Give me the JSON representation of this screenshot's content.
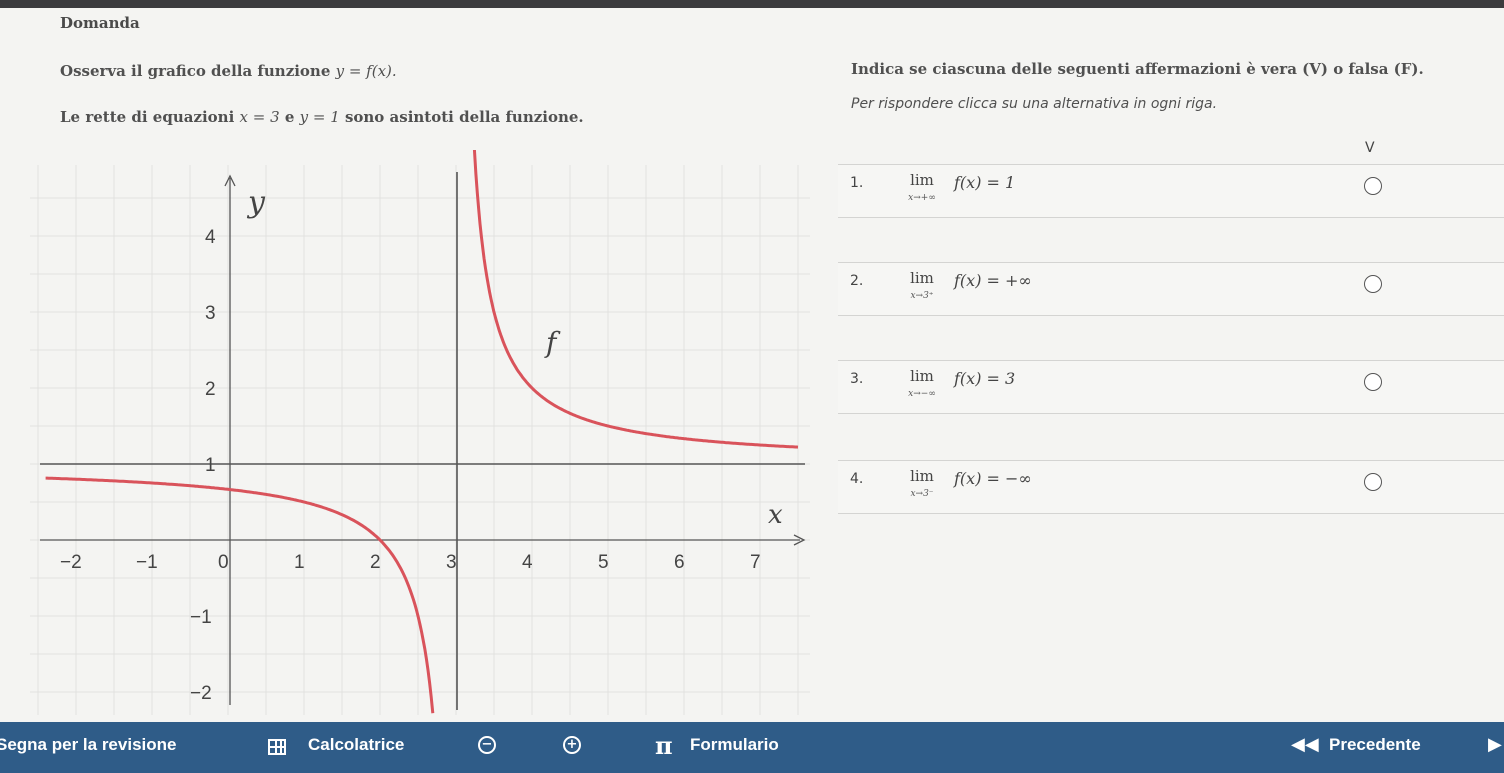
{
  "section": {
    "title": "Domanda"
  },
  "question": {
    "line1_text": "Osserva il grafico della funzione ",
    "line1_math": "y = f(x).",
    "line2_a": "Le rette di equazioni ",
    "line2_m1": "x = 3",
    "line2_b": " e ",
    "line2_m2": "y = 1",
    "line2_c": " sono asintoti della funzione."
  },
  "instructions": {
    "main": "Indica se ciascuna delle seguenti affermazioni  è vera (V) o falsa (F).",
    "hint": "Per rispondere clicca su una alternativa in ogni riga.",
    "column_v": "V"
  },
  "statements": [
    {
      "num": "1.",
      "lim": "lim",
      "sub": "x→+∞",
      "expr": "f(x) = 1"
    },
    {
      "num": "2.",
      "lim": "lim",
      "sub": "x→3⁺",
      "expr": "f(x) = +∞"
    },
    {
      "num": "3.",
      "lim": "lim",
      "sub": "x→−∞",
      "expr": "f(x) = 3"
    },
    {
      "num": "4.",
      "lim": "lim",
      "sub": "x→3⁻",
      "expr": "f(x) = −∞"
    }
  ],
  "graph": {
    "x_axis_label": "x",
    "y_axis_label": "y",
    "function_label": "f",
    "x_ticks": [
      "−2",
      "−1",
      "0",
      "1",
      "2",
      "3",
      "4",
      "5",
      "6",
      "7"
    ],
    "y_ticks": [
      "4",
      "3",
      "2",
      "1",
      "−1",
      "−2"
    ],
    "curve_color": "#d9535b",
    "asymptote_color": "#555555"
  },
  "toolbar": {
    "review": "Segna per la revisione",
    "calculator": "Calcolatrice",
    "zoom_out": "−",
    "zoom_in": "+",
    "formulary": "Formulario",
    "previous": "Precedente"
  },
  "colors": {
    "bottom_bar": "#2f5c88",
    "background": "#f4f4f2"
  }
}
